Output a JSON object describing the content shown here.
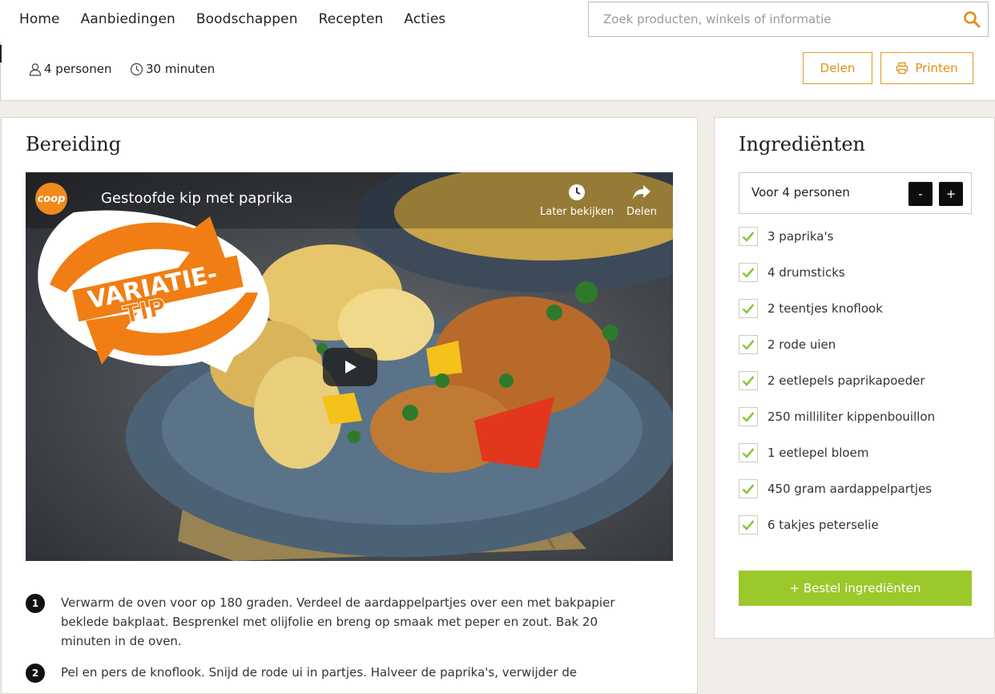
{
  "nav": {
    "items": [
      "Home",
      "Aanbiedingen",
      "Boodschappen",
      "Recepten",
      "Acties"
    ]
  },
  "search": {
    "placeholder": "Zoek producten, winkels of informatie",
    "value": ""
  },
  "recipe_meta": {
    "persons": "4 personen",
    "time": "30 minuten"
  },
  "actions": {
    "share_label": "Delen",
    "print_label": "Printen"
  },
  "preparation": {
    "title": "Bereiding",
    "video": {
      "brand": "coop",
      "title": "Gestoofde kip met paprika",
      "badge_text": "VARIATIE-TIP",
      "watch_later_label": "Later bekijken",
      "share_label": "Delen"
    },
    "steps": [
      {
        "number": "1",
        "text": "Verwarm de oven voor op 180 graden. Verdeel de aardappelpartjes over een met bakpapier beklede bakplaat. Besprenkel met olijfolie en breng op smaak met peper en zout. Bak 20 minuten in de oven."
      },
      {
        "number": "2",
        "text": "Pel en pers de knoflook. Snijd de rode ui in partjes. Halveer de paprika's, verwijder de"
      }
    ]
  },
  "ingredients": {
    "title": "Ingrediënten",
    "portion_label": "Voor 4 personen",
    "minus_label": "-",
    "plus_label": "+",
    "items": [
      {
        "label": "3 paprika's",
        "checked": true
      },
      {
        "label": "4 drumsticks",
        "checked": true
      },
      {
        "label": "2 teentjes knoflook",
        "checked": true
      },
      {
        "label": "2 rode uien",
        "checked": true
      },
      {
        "label": "2 eetlepels paprikapoeder",
        "checked": true
      },
      {
        "label": "250 milliliter kippenbouillon",
        "checked": true
      },
      {
        "label": "1 eetlepel bloem",
        "checked": true
      },
      {
        "label": "450 gram aardappelpartjes",
        "checked": true
      },
      {
        "label": "6 takjes peterselie",
        "checked": true
      }
    ],
    "order_label": "+ Bestel ingrediënten"
  },
  "colors": {
    "accent_orange": "#e0901a",
    "order_green": "#9bc82a",
    "check_green": "#8cc63f",
    "page_bg": "#f1eee9"
  }
}
